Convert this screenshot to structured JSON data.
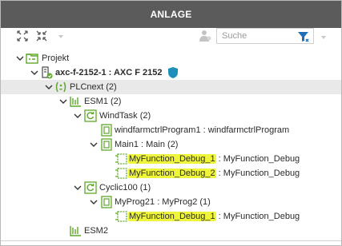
{
  "window": {
    "title": "ANLAGE"
  },
  "toolbar": {
    "search_placeholder": "Suche"
  },
  "tree": {
    "projekt": "Projekt",
    "device_name": "axc-f-2152-1 : AXC F 2152",
    "plcnext": "PLCnext (2)",
    "esm1": "ESM1 (2)",
    "windtask": "WindTask (2)",
    "program1": "windfarmctrlProgram1 : windfarmctrlProgram",
    "main1": "Main1 : Main (2)",
    "fn1_name": "MyFunction_Debug_1",
    "fn1_type": " : MyFunction_Debug",
    "fn2_name": "MyFunction_Debug_2",
    "fn2_type": " : MyFunction_Debug",
    "cyclic100": "Cyclic100 (1)",
    "myprog21": "MyProg21 : MyProg2 (1)",
    "fn3_name": "MyFunction_Debug_1",
    "fn3_type": " : MyFunction_Debug",
    "esm2": "ESM2"
  },
  "colors": {
    "titlebar": "#5b5b5b",
    "accent_green": "#5fa82a",
    "highlight": "#eef53b",
    "icon_blue": "#1d8fb8",
    "filter_blue": "#1e6fb5"
  },
  "icons": [
    "expand-all-icon",
    "collapse-all-icon",
    "user-icon",
    "filter-icon",
    "chevron-down-icon",
    "folder-icon",
    "device-icon",
    "shield-icon",
    "plcnext-icon",
    "esm-icon",
    "task-icon",
    "program-icon",
    "function-icon"
  ]
}
